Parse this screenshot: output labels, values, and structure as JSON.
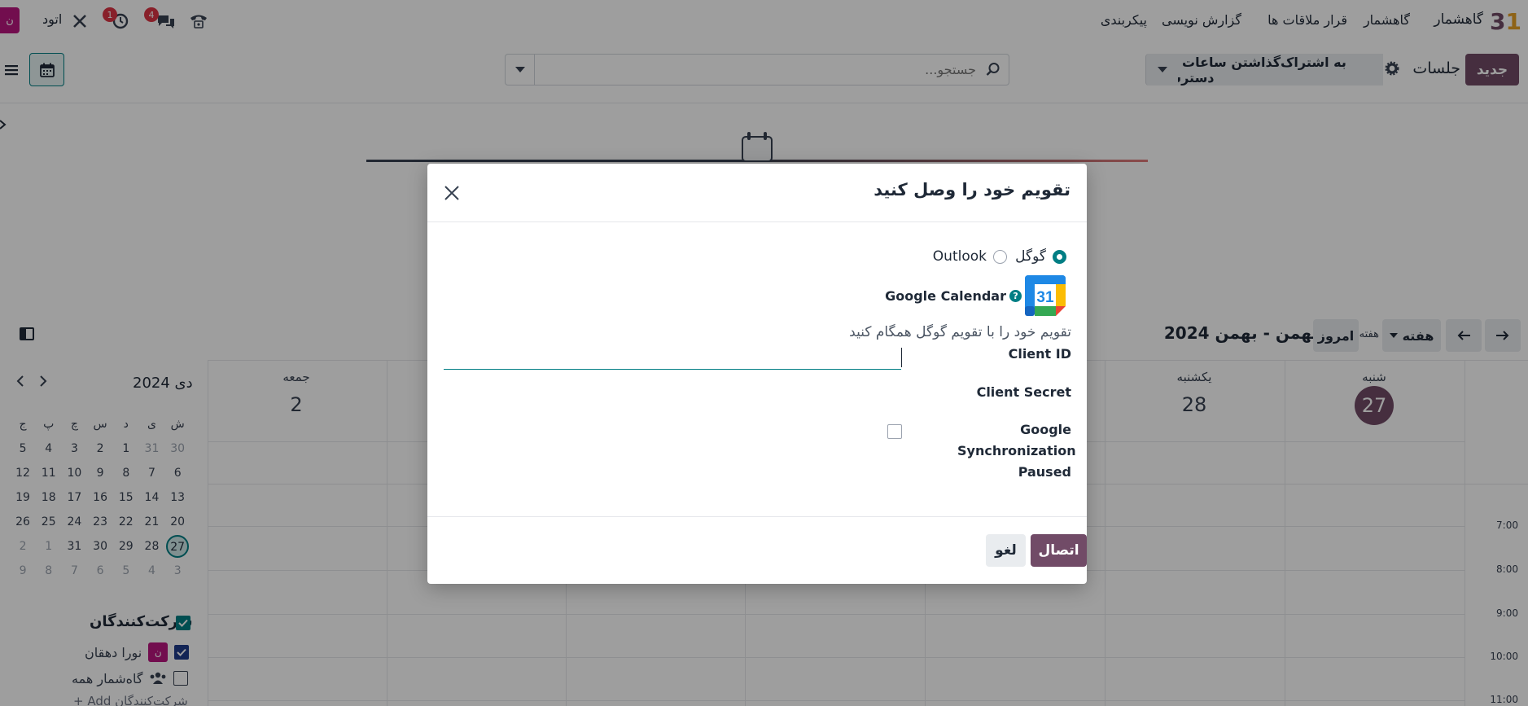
{
  "navbar": {
    "app_name": "گاهشمار",
    "menu": [
      "گاهشمار",
      "قرار ملاقات ها",
      "گزارش نویسی",
      "پیکربندی"
    ],
    "company": "اتود",
    "user_initial": "ن",
    "badges": {
      "messages": "4",
      "activities": "1"
    }
  },
  "control_panel": {
    "new_label": "جدید",
    "title": "جلسات",
    "share_label": "به اشتراک‌گذاشتن ساعات در دسترس",
    "search_placeholder": "جستجو..."
  },
  "calendar": {
    "range_title": "بهمن - بهمن 2024",
    "week_label": "هفته 4",
    "today_label": "امروز",
    "scale_label": "هفته",
    "days": [
      {
        "name": "شنبه",
        "num": "27",
        "today": true
      },
      {
        "name": "یکشنبه",
        "num": "28",
        "today": false
      },
      {
        "name": "جمعه",
        "num": "2",
        "today": false
      }
    ],
    "hours": [
      "7:00",
      "8:00",
      "9:00",
      "10:00",
      "11:00"
    ]
  },
  "mini_calendar": {
    "title": "دی 2024",
    "weekdays": [
      "ش",
      "ی",
      "د",
      "س",
      "چ",
      "پ",
      "ج"
    ],
    "weeks": [
      [
        "30",
        "31",
        "1",
        "2",
        "3",
        "4",
        "5"
      ],
      [
        "6",
        "7",
        "8",
        "9",
        "10",
        "11",
        "12"
      ],
      [
        "13",
        "14",
        "15",
        "16",
        "17",
        "18",
        "19"
      ],
      [
        "20",
        "21",
        "22",
        "23",
        "24",
        "25",
        "26"
      ],
      [
        "27",
        "28",
        "29",
        "30",
        "31",
        "1",
        "2"
      ],
      [
        "3",
        "4",
        "5",
        "6",
        "7",
        "8",
        "9"
      ]
    ]
  },
  "filters": {
    "title": "شرکت‌کنندگان",
    "items": [
      {
        "label": "نورا دهقان",
        "checked": true
      },
      {
        "label": "گاه‌شمار همه",
        "checked": false
      }
    ],
    "add_label": "+ Add شرکت‌کنندگان"
  },
  "dialog": {
    "title": "تقویم خود را وصل کنید",
    "providers": [
      {
        "label": "گوگل",
        "selected": true
      },
      {
        "label": "Outlook",
        "selected": false
      }
    ],
    "google_calendar_label": "Google Calendar",
    "google_calendar_logo_text": "31",
    "help_glyph": "?",
    "sync_description": "تقویم خود را با تقویم گوگل همگام کنید",
    "fields": {
      "client_id_label": "Client ID",
      "client_id_value": "",
      "client_secret_label": "Client Secret",
      "sync_paused_label": "Google Synchronization Paused"
    },
    "connect_label": "اتصال",
    "cancel_label": "لغو"
  },
  "colors": {
    "brand": "#714b67",
    "teal": "#017e84"
  }
}
